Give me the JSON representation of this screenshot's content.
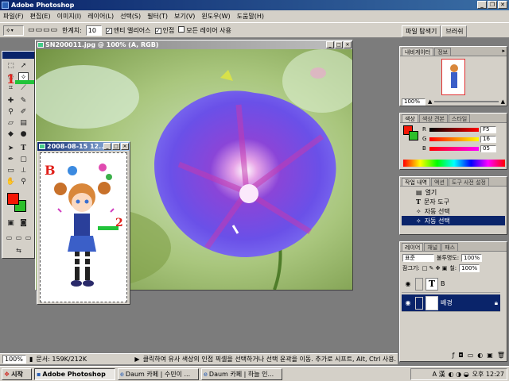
{
  "title": "Adobe Photoshop",
  "menu": [
    "파일(F)",
    "편집(E)",
    "이미지(I)",
    "레이어(L)",
    "선택(S)",
    "필터(T)",
    "보기(V)",
    "윈도우(W)",
    "도움말(H)"
  ],
  "options": {
    "tolerance_label": "한계치:",
    "tolerance_value": "10",
    "antialias_label": "앤티 앨리어스",
    "contiguous_label": "인접",
    "all_layers_label": "모든 레이어 사용",
    "file_browser_tab": "파일 탐색기",
    "brushes_tab": "브러쉬"
  },
  "doc_main": {
    "title": "SN200011.jpg @ 100% (A, RGB)"
  },
  "doc_small": {
    "title": "2008-08-15 12..."
  },
  "annotations": {
    "a": "A",
    "b": "B",
    "one": "1",
    "two": "2"
  },
  "navigator": {
    "tabs": [
      "내비게이터",
      "정보"
    ],
    "zoom": "100%"
  },
  "color_panel": {
    "tabs": [
      "색상",
      "색상 견본",
      "스타일"
    ],
    "channels": [
      {
        "name": "R",
        "value": "F5"
      },
      {
        "name": "G",
        "value": "16"
      },
      {
        "name": "B",
        "value": "05"
      }
    ]
  },
  "history": {
    "tabs": [
      "작업 내역",
      "액션",
      "도구 사전 설정"
    ],
    "items": [
      "열기",
      "문자 도구",
      "자동 선택",
      "자동 선택"
    ]
  },
  "layers_panel": {
    "tabs": [
      "레이어",
      "채널",
      "패스"
    ],
    "blend": "표준",
    "opacity_label": "불투명도:",
    "opacity": "100%",
    "lock_label": "잠그기:",
    "fill_label": "칠:",
    "fill": "100%",
    "layers": [
      {
        "name": "B",
        "type": "text"
      },
      {
        "name": "배경",
        "type": "image"
      }
    ]
  },
  "status": {
    "zoom": "100%",
    "doc": "문서: 159K/212K",
    "hint": "클릭하여 유사 색상의 인접 픽셀을 선택하거나 선택 윤곽을 이동. 추가로 시프트, Alt, Ctrl 사용."
  },
  "taskbar": {
    "start": "시작",
    "tasks": [
      "Adobe Photoshop",
      "Daum 카페 | 수민이 ...",
      "Daum 카페 | 하늘 인..."
    ],
    "tray_lang": "A 漢",
    "clock": "오후 12:27"
  },
  "colors": {
    "foreground": "#f51605",
    "background": "#2bbf2b"
  }
}
